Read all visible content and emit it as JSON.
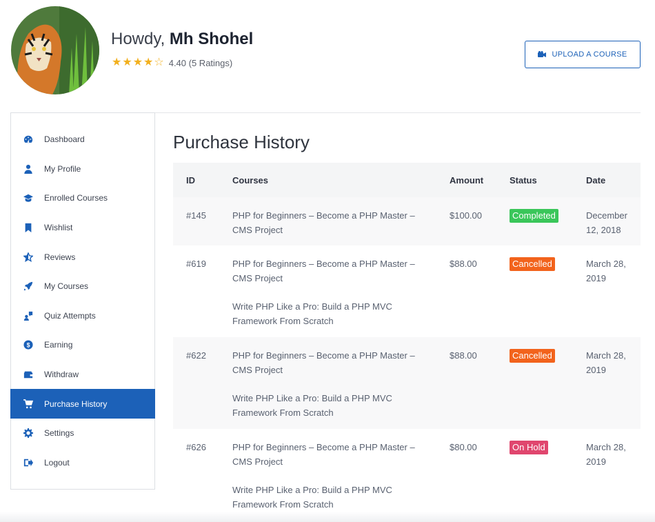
{
  "header": {
    "greeting": "Howdy,",
    "user_name": "Mh Shohel",
    "rating_value": 4.4,
    "rating_text": "4.40 (5 Ratings)",
    "star_color": "#f2b01e",
    "upload_button": "UPLOAD A COURSE"
  },
  "sidebar": {
    "active_color": "#1c61b8",
    "items": [
      {
        "label": "Dashboard",
        "icon": "dashboard-icon"
      },
      {
        "label": "My Profile",
        "icon": "user-icon"
      },
      {
        "label": "Enrolled Courses",
        "icon": "graduation-cap-icon"
      },
      {
        "label": "Wishlist",
        "icon": "bookmark-icon"
      },
      {
        "label": "Reviews",
        "icon": "star-icon"
      },
      {
        "label": "My Courses",
        "icon": "rocket-icon"
      },
      {
        "label": "Quiz Attempts",
        "icon": "quiz-icon"
      },
      {
        "label": "Earning",
        "icon": "dollar-icon"
      },
      {
        "label": "Withdraw",
        "icon": "wallet-icon"
      },
      {
        "label": "Purchase History",
        "icon": "cart-icon",
        "active": true
      },
      {
        "label": "Settings",
        "icon": "gear-icon"
      },
      {
        "label": "Logout",
        "icon": "logout-icon"
      }
    ]
  },
  "main": {
    "title": "Purchase History",
    "columns": [
      "ID",
      "Courses",
      "Amount",
      "Status",
      "Date"
    ],
    "rows": [
      {
        "id": "#145",
        "courses": [
          [
            "PHP for Beginners – Become a PHP Master –",
            "CMS Project"
          ]
        ],
        "amount": "$100.00",
        "status": "Completed",
        "status_color": "#3ac65a",
        "date": [
          "December",
          "12, 2018"
        ]
      },
      {
        "id": "#619",
        "courses": [
          [
            "PHP for Beginners – Become a PHP Master –",
            "CMS Project"
          ],
          [
            "Write PHP Like a Pro: Build a PHP MVC",
            "Framework From Scratch"
          ]
        ],
        "amount": "$88.00",
        "status": "Cancelled",
        "status_color": "#f2631c",
        "date": [
          "March 28,",
          "2019"
        ]
      },
      {
        "id": "#622",
        "courses": [
          [
            "PHP for Beginners – Become a PHP Master –",
            "CMS Project"
          ],
          [
            "Write PHP Like a Pro: Build a PHP MVC",
            "Framework From Scratch"
          ]
        ],
        "amount": "$88.00",
        "status": "Cancelled",
        "status_color": "#f2631c",
        "date": [
          "March 28,",
          "2019"
        ]
      },
      {
        "id": "#626",
        "courses": [
          [
            "PHP for Beginners – Become a PHP Master –",
            "CMS Project"
          ],
          [
            "Write PHP Like a Pro: Build a PHP MVC",
            "Framework From Scratch"
          ]
        ],
        "amount": "$80.00",
        "status": "On Hold",
        "status_color": "#e0466e",
        "date": [
          "March 28,",
          "2019"
        ]
      }
    ]
  }
}
